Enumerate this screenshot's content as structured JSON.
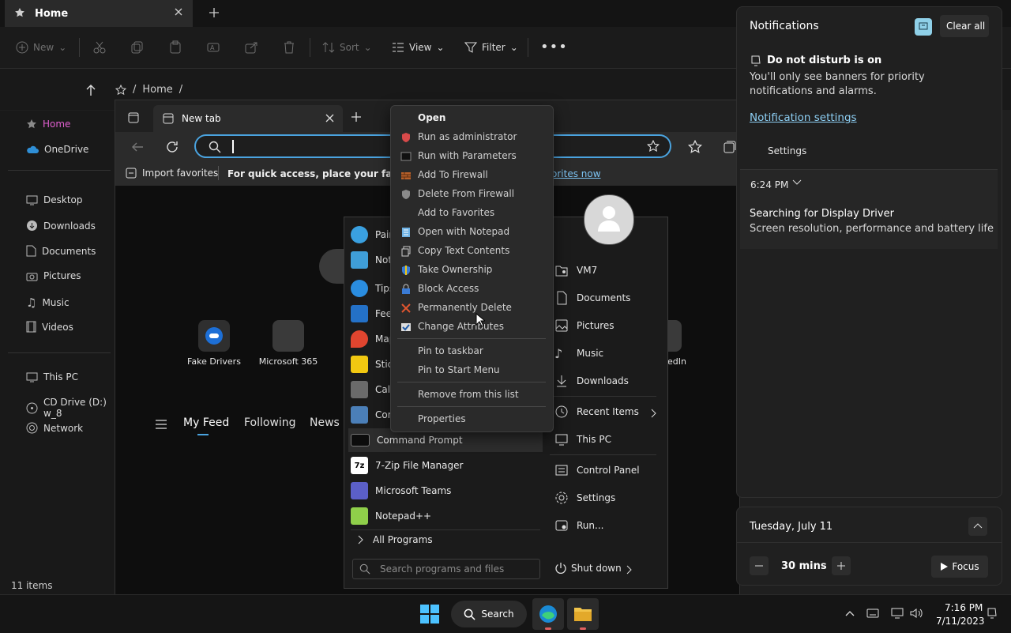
{
  "explorer": {
    "tab_title": "Home",
    "toolbar": {
      "new": "New",
      "sort": "Sort",
      "view": "View",
      "filter": "Filter"
    },
    "breadcrumb": {
      "sep1": "/",
      "home": "Home",
      "sep2": "/"
    },
    "sidebar": {
      "home": "Home",
      "onedrive": "OneDrive",
      "desktop": "Desktop",
      "downloads": "Downloads",
      "documents": "Documents",
      "pictures": "Pictures",
      "music": "Music",
      "videos": "Videos",
      "thispc": "This PC",
      "cddrive": "CD Drive (D:) w_8",
      "network": "Network"
    },
    "status": "11 items"
  },
  "edge": {
    "tab_title": "New tab",
    "favbar": {
      "import": "Import favorites",
      "hint": "For quick access, place your favorites h",
      "link": "orites now"
    },
    "quicklinks": {
      "fake_drivers": "Fake Drivers",
      "m365": "Microsoft 365",
      "linkedin_frag": "edIn"
    },
    "feed_tabs": {
      "myfeed": "My Feed",
      "following": "Following",
      "news": "News"
    }
  },
  "context_menu": {
    "open": "Open",
    "run_admin": "Run as administrator",
    "run_params": "Run with Parameters",
    "add_fw": "Add To Firewall",
    "del_fw": "Delete From Firewall",
    "add_fav": "Add to Favorites",
    "open_notepad": "Open with Notepad",
    "copy_text": "Copy Text Contents",
    "take_own": "Take Ownership",
    "block": "Block Access",
    "perm_del": "Permanently Delete",
    "change_attr": "Change Attributes",
    "pin_taskbar": "Pin to taskbar",
    "pin_start": "Pin to Start Menu",
    "remove": "Remove from this list",
    "properties": "Properties"
  },
  "start_menu": {
    "programs": {
      "p1": "Pain",
      "p2": "Not",
      "p3": "Tips",
      "p4": "Feed",
      "p5": "Map",
      "p6": "Stic",
      "p7": "Calc",
      "p8": "Con",
      "cmd": "Command Prompt",
      "zip": "7-Zip File Manager",
      "teams": "Microsoft Teams",
      "notepadpp": "Notepad++"
    },
    "all_programs": "All Programs",
    "search_placeholder": "Search programs and files",
    "right": {
      "vm7": "VM7",
      "documents": "Documents",
      "pictures": "Pictures",
      "music": "Music",
      "downloads": "Downloads",
      "recent": "Recent Items",
      "thispc": "This PC",
      "control": "Control Panel",
      "settings": "Settings",
      "run": "Run..."
    },
    "shutdown": "Shut down"
  },
  "notifications": {
    "title": "Notifications",
    "clear_all": "Clear all",
    "dnd_title": "Do not disturb is on",
    "dnd_body": "You'll only see banners for priority notifications and alarms.",
    "settings_link": "Notification settings",
    "settings_btn": "Settings",
    "time": "6:24 PM",
    "card_title": "Searching for Display Driver",
    "card_body": "Screen resolution, performance and battery life"
  },
  "calendar": {
    "date": "Tuesday, July 11",
    "focus_minutes": "30 mins",
    "focus": "Focus"
  },
  "taskbar": {
    "search": "Search",
    "time": "7:16 PM",
    "date": "7/11/2023"
  },
  "colors": {
    "accent": "#4aa3df",
    "home_pink": "#e05fd0",
    "link_blue": "#7cc3f2"
  }
}
